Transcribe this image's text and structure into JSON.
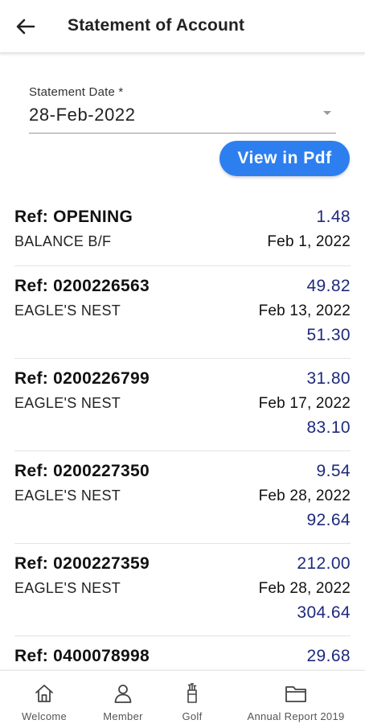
{
  "header": {
    "title": "Statement of Account",
    "back_icon": "arrow-left-icon"
  },
  "statement_date": {
    "label": "Statement Date *",
    "value": "28-Feb-2022"
  },
  "pdf_button": {
    "label": "View in Pdf",
    "color": "#2d7ff0"
  },
  "colors": {
    "amount": "#1e2a7c",
    "accent": "#2d7ff0"
  },
  "transactions": [
    {
      "ref": "Ref: OPENING",
      "desc": "BALANCE B/F",
      "amount": "1.48",
      "date": "Feb 1, 2022",
      "balance": ""
    },
    {
      "ref": "Ref: 0200226563",
      "desc": "EAGLE'S NEST",
      "amount": "49.82",
      "date": "Feb 13, 2022",
      "balance": "51.30"
    },
    {
      "ref": "Ref: 0200226799",
      "desc": "EAGLE'S NEST",
      "amount": "31.80",
      "date": "Feb 17, 2022",
      "balance": "83.10"
    },
    {
      "ref": "Ref: 0200227350",
      "desc": "EAGLE'S NEST",
      "amount": "9.54",
      "date": "Feb 28, 2022",
      "balance": "92.64"
    },
    {
      "ref": "Ref: 0200227359",
      "desc": "EAGLE'S NEST",
      "amount": "212.00",
      "date": "Feb 28, 2022",
      "balance": "304.64"
    },
    {
      "ref": "Ref: 0400078998",
      "desc": "",
      "amount": "29.68",
      "date": "",
      "balance": ""
    }
  ],
  "bottom_nav": [
    {
      "label": "Welcome",
      "icon": "home-icon"
    },
    {
      "label": "Member",
      "icon": "person-icon"
    },
    {
      "label": "Golf",
      "icon": "golf-bag-icon"
    },
    {
      "label": "Annual Report 2019",
      "icon": "folder-icon"
    }
  ]
}
